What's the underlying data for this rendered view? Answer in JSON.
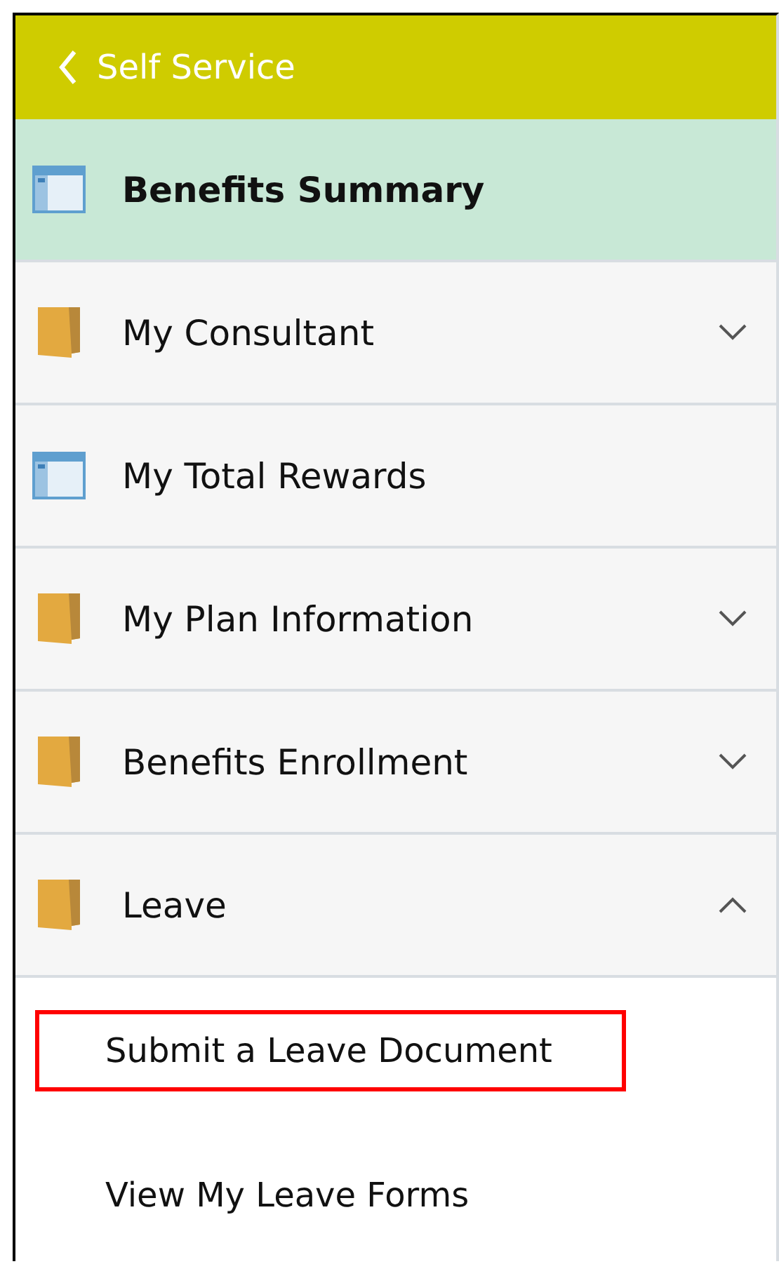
{
  "header": {
    "back_label": "Self Service"
  },
  "items": [
    {
      "label": "Benefits Summary",
      "kind": "page",
      "selected": true
    },
    {
      "label": "My Consultant",
      "kind": "folder",
      "selected": false,
      "expanded": false
    },
    {
      "label": "My Total Rewards",
      "kind": "page",
      "selected": false
    },
    {
      "label": "My Plan Information",
      "kind": "folder",
      "selected": false,
      "expanded": false
    },
    {
      "label": "Benefits Enrollment",
      "kind": "folder",
      "selected": false,
      "expanded": false
    },
    {
      "label": "Leave",
      "kind": "folder",
      "selected": false,
      "expanded": true,
      "children": [
        {
          "label": "Submit a Leave Document",
          "highlighted": true
        },
        {
          "label": "View My Leave Forms",
          "highlighted": false
        }
      ]
    }
  ]
}
